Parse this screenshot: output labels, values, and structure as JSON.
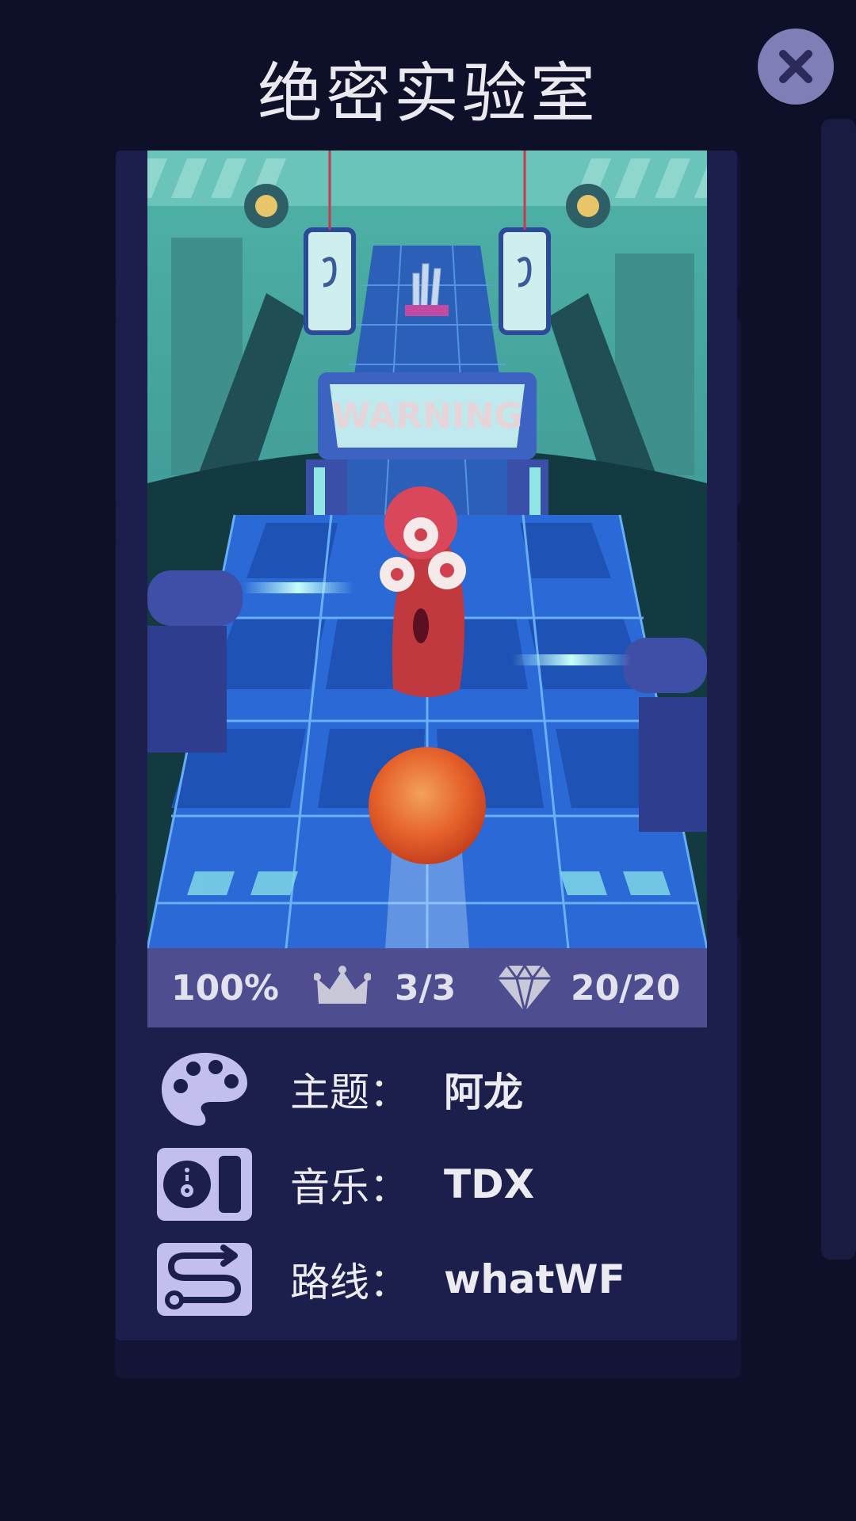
{
  "title": "绝密实验室",
  "close_icon": "close-icon",
  "artwork": {
    "sign_text": "WARNING"
  },
  "stats": {
    "progress": "100%",
    "crowns": "3/3",
    "gems": "20/20",
    "crown_icon": "crown-icon",
    "gem_icon": "diamond-icon"
  },
  "info": [
    {
      "icon": "palette-icon",
      "label": "主题：",
      "value": "阿龙"
    },
    {
      "icon": "music-icon",
      "label": "音乐：",
      "value": "TDX"
    },
    {
      "icon": "route-icon",
      "label": "路线：",
      "value": "whatWF"
    }
  ],
  "colors": {
    "background": "#0e0f28",
    "card": "#1c1f4c",
    "stats_bar": "#4d4d8f",
    "icon_tile": "#c2bef0",
    "close_button": "#7f7eb6",
    "ball": "#e86a2c"
  }
}
